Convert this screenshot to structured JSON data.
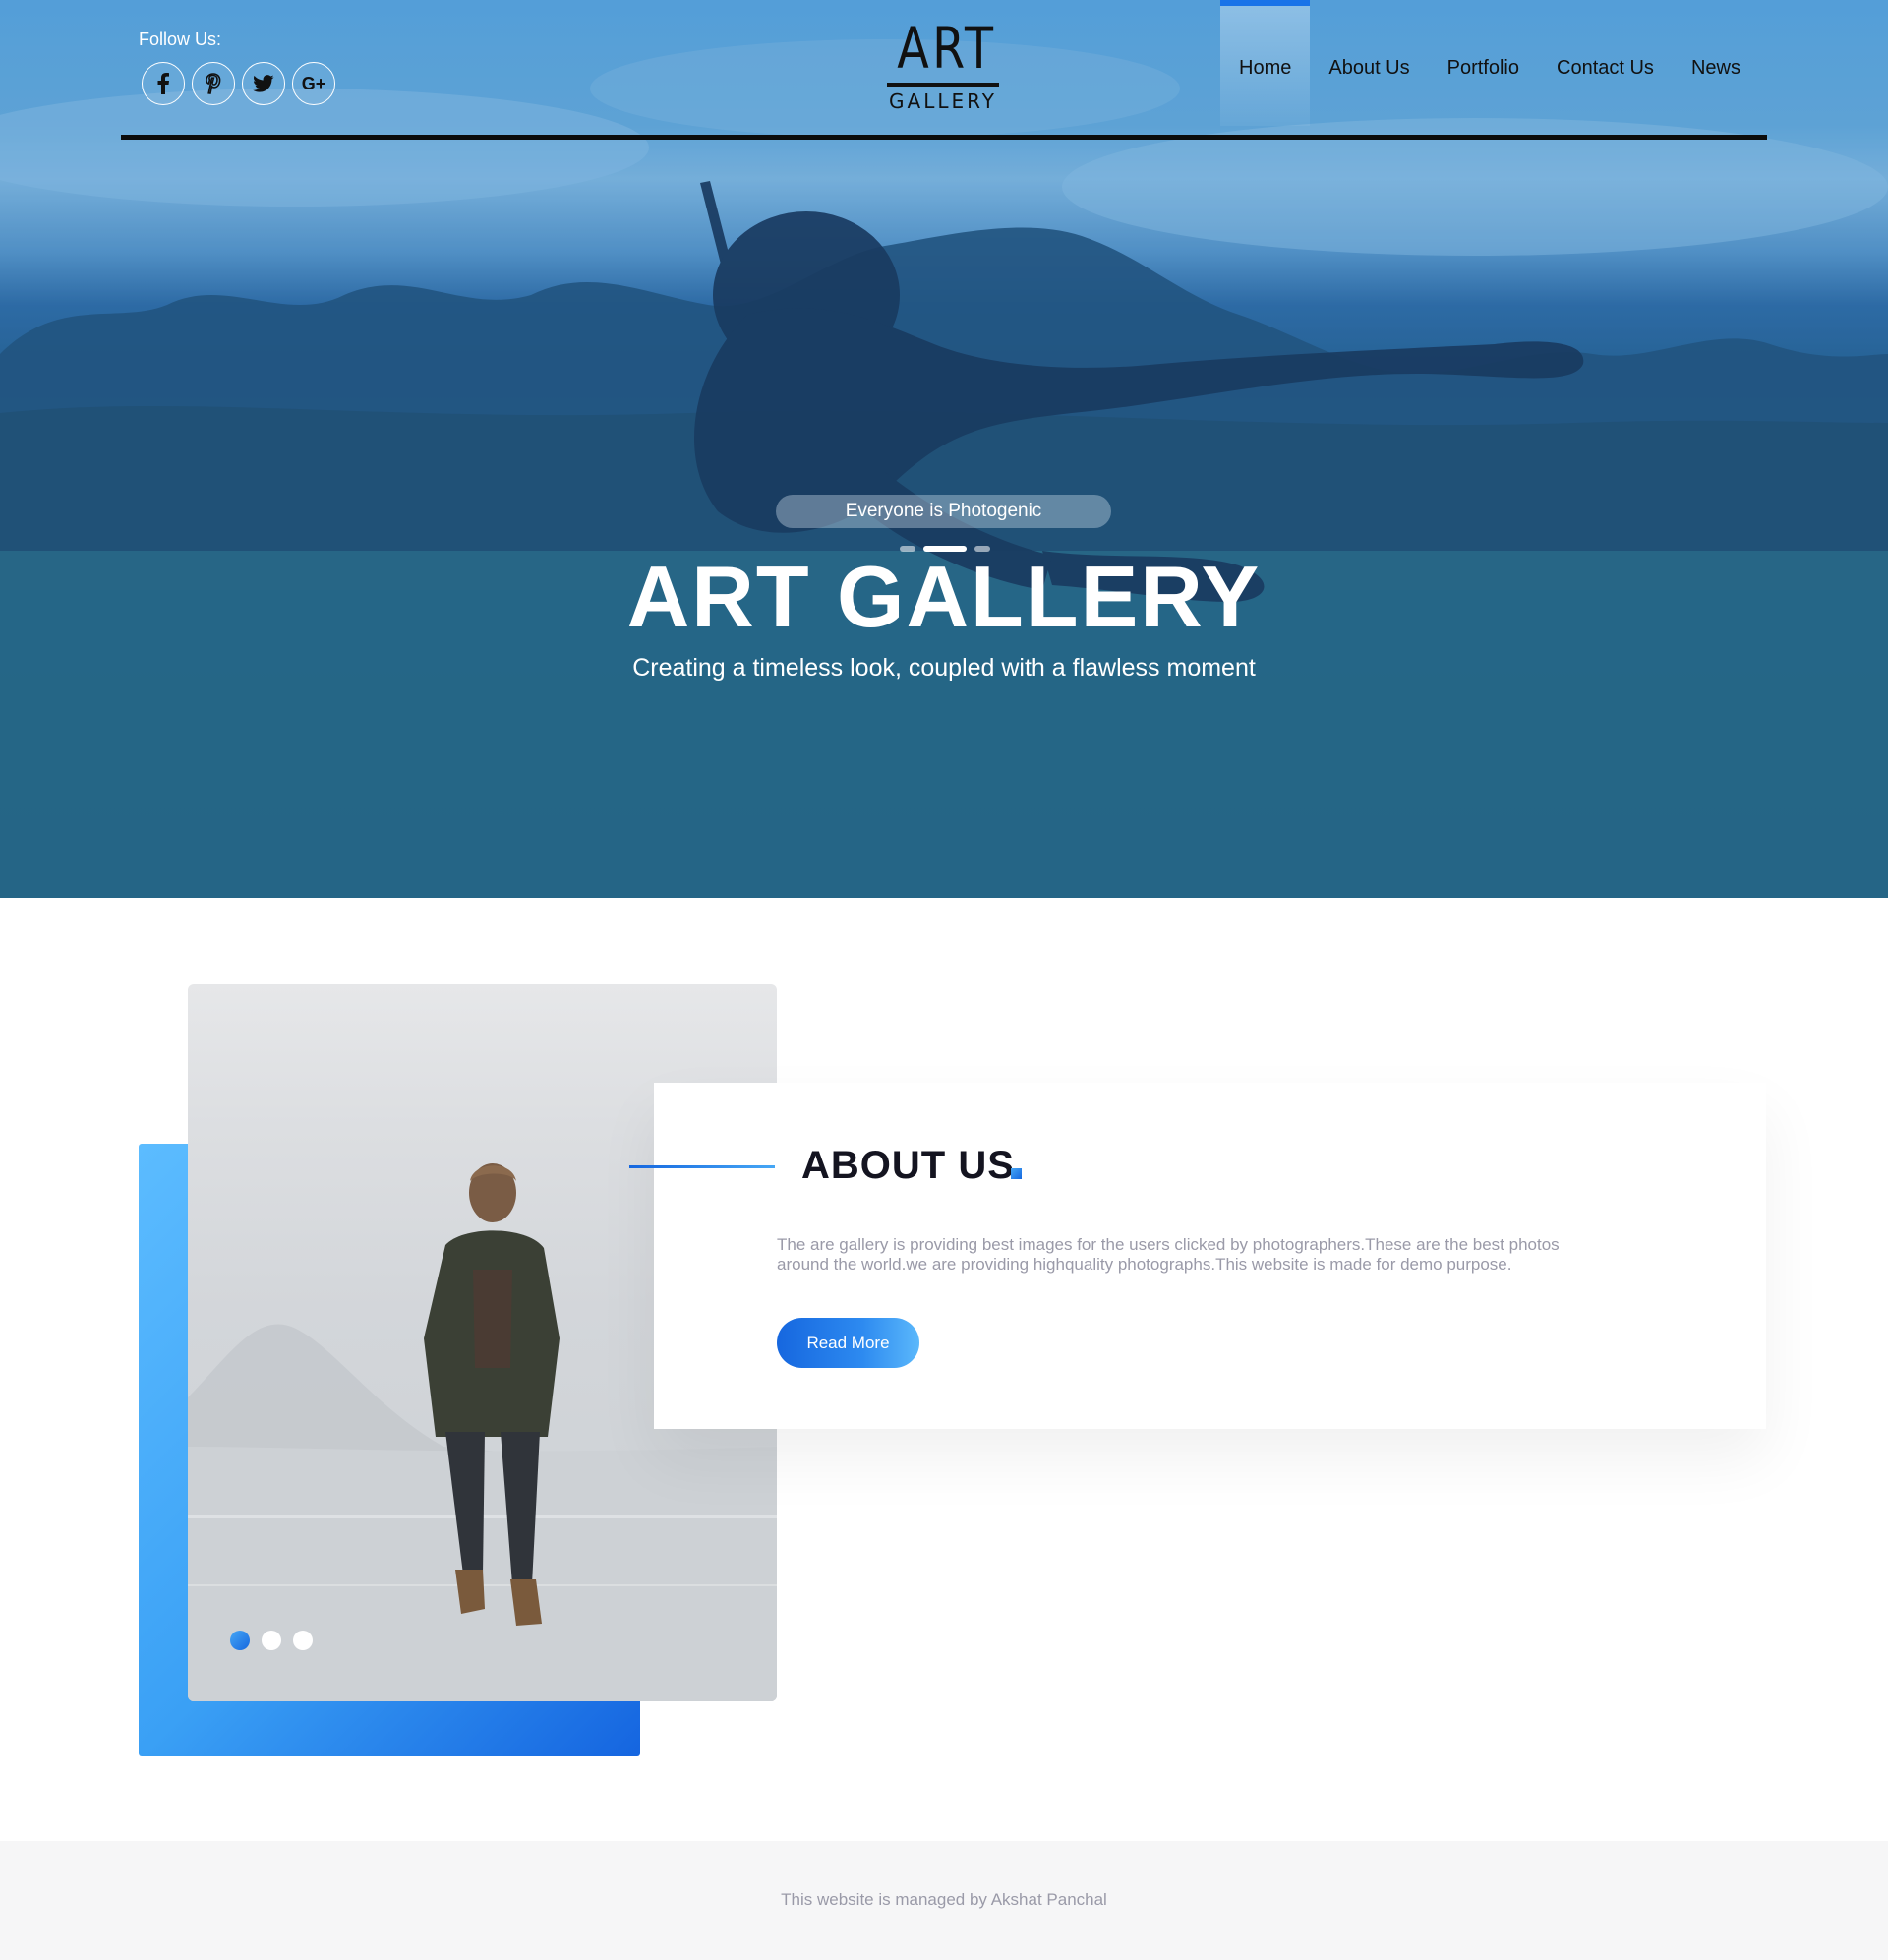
{
  "header": {
    "follow_label": "Follow Us:",
    "socials": [
      {
        "name": "facebook",
        "icon": "facebook-icon"
      },
      {
        "name": "pinterest",
        "icon": "pinterest-icon"
      },
      {
        "name": "twitter",
        "icon": "twitter-icon"
      },
      {
        "name": "google-plus",
        "icon": "google-plus-icon",
        "glyph": "G+"
      }
    ],
    "logo": {
      "main": "ART",
      "sub": "GALLERY"
    },
    "nav": [
      {
        "label": "Home",
        "active": true
      },
      {
        "label": "About Us",
        "active": false
      },
      {
        "label": "Portfolio",
        "active": false
      },
      {
        "label": "Contact Us",
        "active": false
      },
      {
        "label": "News",
        "active": false
      }
    ]
  },
  "hero": {
    "tagline": "Everyone is Photogenic",
    "title": "ART GALLERY",
    "subtitle": "Creating a timeless look, coupled with a flawless moment",
    "slides_total": 3,
    "active_slide": 2
  },
  "about": {
    "title": "ABOUT US",
    "text": "The are gallery is providing best images for the users clicked by photographers.These are the best photos around the world.we are providing highquality photographs.This website is made for demo purpose.",
    "button_label": "Read More",
    "slides_total": 3,
    "active_slide": 1
  },
  "footer": {
    "text": "This website is managed by Akshat Panchal"
  },
  "colors": {
    "accent": "#1a73e8",
    "accent_light": "#5cbcff",
    "muted_text": "#9a9aa8",
    "footer_bg": "#f6f6f7"
  }
}
